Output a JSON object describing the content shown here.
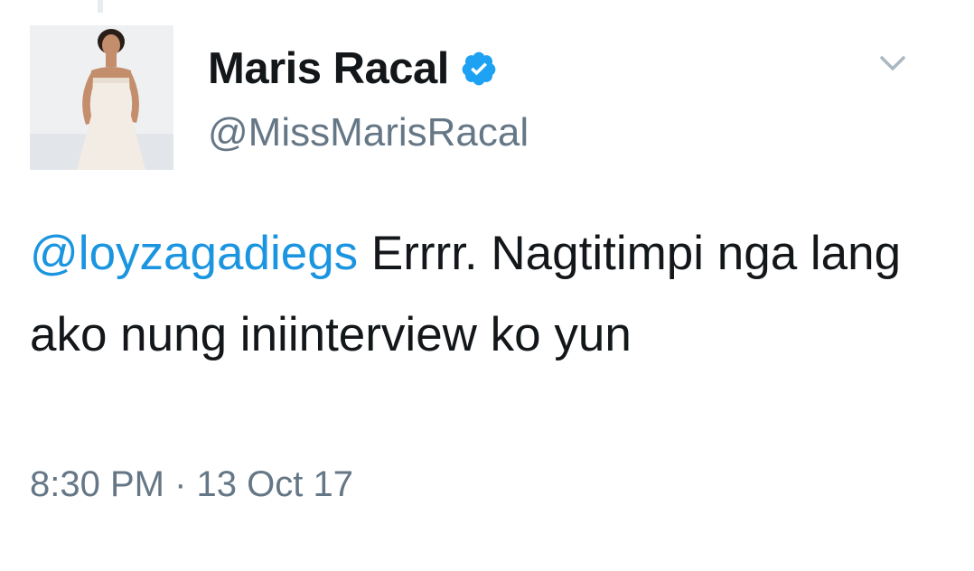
{
  "tweet": {
    "display_name": "Maris Racal",
    "handle": "@MissMarisRacal",
    "verified": true,
    "mention": "@loyzagadiegs",
    "text_after_mention": " Errrr. Nagtitimpi nga lang ako nung iniinterview ko yun",
    "timestamp": "8:30 PM · 13 Oct 17"
  },
  "colors": {
    "mention": "#1b95e0",
    "verified_badge": "#1da1f2",
    "secondary_text": "#657786"
  },
  "icons": {
    "verified": "verified-badge-icon",
    "menu": "chevron-down-icon"
  }
}
